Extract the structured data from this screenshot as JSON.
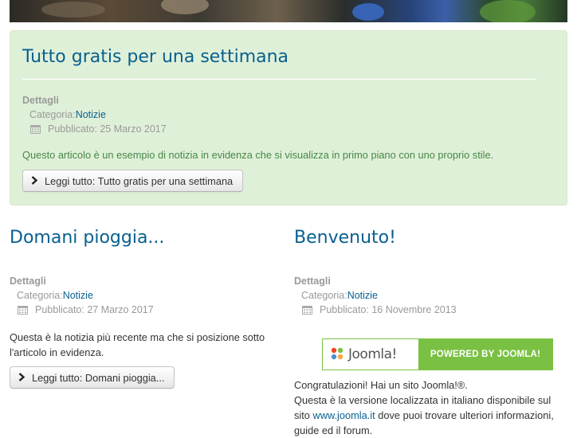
{
  "featured": {
    "title": "Tutto gratis per una settimana",
    "details_label": "Dettagli",
    "category_prefix": "Categoria: ",
    "category_link": "Notizie",
    "published": "Pubblicato: 25 Marzo 2017",
    "intro": "Questo articolo è un esempio di notizia in evidenza che si visualizza in primo piano con uno proprio stile.",
    "read_more": "Leggi tutto: Tutto gratis per una settimana"
  },
  "left_article": {
    "title": "Domani pioggia...",
    "details_label": "Dettagli",
    "category_prefix": "Categoria: ",
    "category_link": "Notizie",
    "published": "Pubblicato: 27 Marzo 2017",
    "intro_line1": "Questa è la notizia più recente ma che si posizione sotto",
    "intro_line2": "l'articolo in evidenza.",
    "read_more": "Leggi tutto: Domani pioggia..."
  },
  "right_article": {
    "title": "Benvenuto!",
    "details_label": "Dettagli",
    "category_prefix": "Categoria: ",
    "category_link": "Notizie",
    "published": "Pubblicato: 16 Novembre 2013",
    "banner_logo_text": "Joomla!",
    "banner_powered": "POWERED BY JOOMLA!",
    "text_line1": "Congratulazioni! Hai un sito Joomla!®.",
    "text_line2": "Questa è la versione localizzata in italiano disponibile sul",
    "text_line3_prefix": "sito ",
    "text_line3_link": "www.joomla.it",
    "text_line3_suffix": " dove puoi trovare ulteriori informazioni,",
    "text_line4": "guide ed il forum."
  },
  "colors": {
    "title": "#08608f",
    "featured_bg": "#dff0d8",
    "featured_text": "#468847",
    "joomla_green": "#7ac143"
  },
  "icons": [
    "calendar-icon",
    "chevron-right-icon",
    "joomla-logo-icon"
  ]
}
